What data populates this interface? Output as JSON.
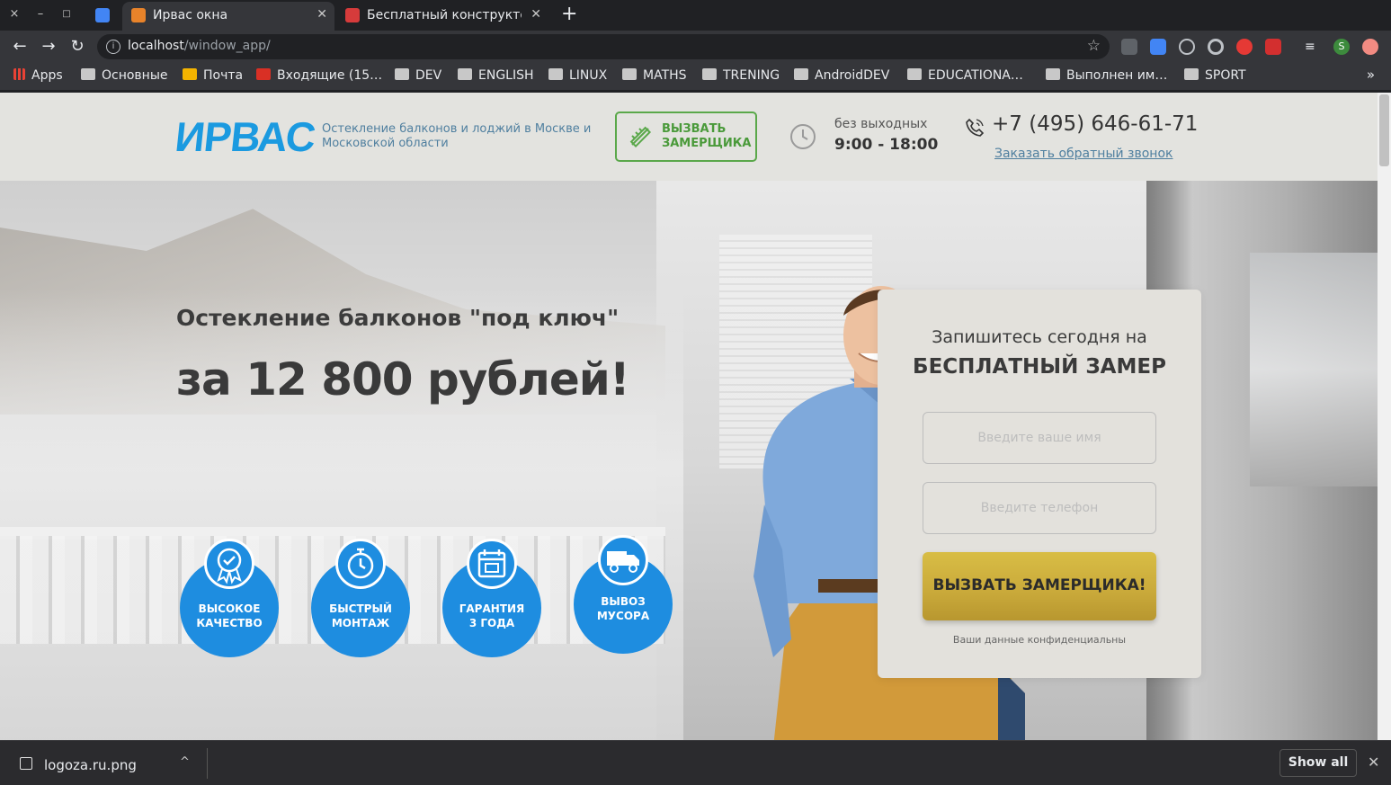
{
  "browser": {
    "window_controls": [
      "×",
      "–",
      "□"
    ],
    "tabs": [
      {
        "title": "Ирвас окна",
        "favicon_color": "#e8832a",
        "active": true
      },
      {
        "title": "Бесплатный конструктор",
        "favicon_color": "#d63b3b",
        "active": false
      }
    ],
    "new_tab": "+",
    "url": {
      "host": "localhost",
      "path": "/window_app/"
    },
    "bookmarks": [
      {
        "label": "Apps",
        "icon": "apps-grid-icon"
      },
      {
        "label": "Основные",
        "icon": "folder-icon"
      },
      {
        "label": "Почта",
        "icon": "mail-icon"
      },
      {
        "label": "Входящие (15…",
        "icon": "gmail-icon"
      },
      {
        "label": "DEV",
        "icon": "folder-icon"
      },
      {
        "label": "ENGLISH",
        "icon": "folder-icon"
      },
      {
        "label": "LINUX",
        "icon": "folder-icon"
      },
      {
        "label": "MATHS",
        "icon": "folder-icon"
      },
      {
        "label": "TRENING",
        "icon": "folder-icon"
      },
      {
        "label": "AndroidDEV",
        "icon": "folder-icon"
      },
      {
        "label": "EDUCATIONA…",
        "icon": "folder-icon"
      },
      {
        "label": "Выполнен им…",
        "icon": "folder-icon"
      },
      {
        "label": "SPORT",
        "icon": "folder-icon"
      }
    ],
    "bookmarks_more": "»",
    "profile_initial": "S"
  },
  "site": {
    "logo": "ИРВАС",
    "tagline": "Остекление балконов и лоджий в Москве и Московской области",
    "measure_button": "ВЫЗВАТЬ ЗАМЕРЩИКА",
    "hours_label": "без выходных",
    "hours_value": "9:00 - 18:00",
    "phone": "+7 (495) 646-61-71",
    "callback_link": "Заказать обратный звонок"
  },
  "hero": {
    "subtitle": "Остекление балконов \"под ключ\"",
    "price": "за 12 800 рублей!",
    "badges": [
      {
        "label": "ВЫСОКОЕ\nКАЧЕСТВО",
        "icon": "quality-ribbon-icon"
      },
      {
        "label": "БЫСТРЫЙ\nМОНТАЖ",
        "icon": "stopwatch-icon"
      },
      {
        "label": "ГАРАНТИЯ\n3 ГОДА",
        "icon": "calendar-icon"
      },
      {
        "label": "ВЫВОЗ\nМУСОРА",
        "icon": "truck-icon"
      }
    ]
  },
  "form": {
    "title_line1": "Запишитесь сегодня на",
    "title_line2": "БЕСПЛАТНЫЙ ЗАМЕР",
    "name_placeholder": "Введите ваше имя",
    "phone_placeholder": "Введите телефон",
    "submit_label": "ВЫЗВАТЬ ЗАМЕРЩИКА!",
    "privacy_note": "Ваши данные конфиденциальны"
  },
  "downloads": {
    "file_name": "logoza.ru.png",
    "show_all": "Show all"
  },
  "colors": {
    "brand_blue": "#1e8de0",
    "accent_green": "#5aa84a",
    "cta_gold": "#c9a93a"
  }
}
